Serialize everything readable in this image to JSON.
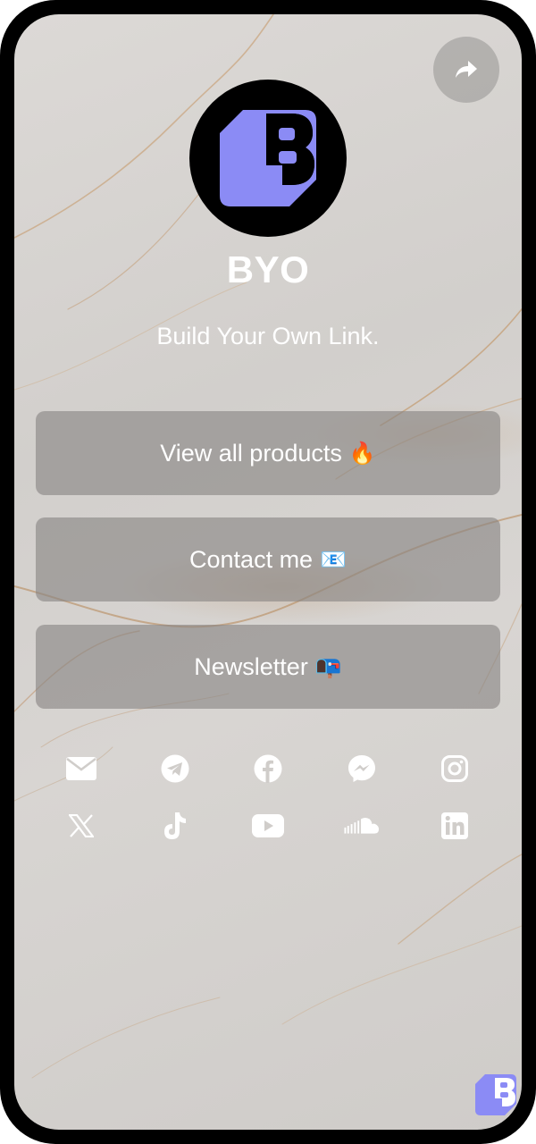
{
  "profile": {
    "name": "BYO",
    "bio": "Build Your Own Link."
  },
  "links": [
    {
      "label": "View all products",
      "emoji": "🔥"
    },
    {
      "label": "Contact me",
      "emoji": "📧"
    },
    {
      "label": "Newsletter",
      "emoji": "📭"
    }
  ],
  "socials": {
    "row1": [
      "email-icon",
      "telegram-icon",
      "facebook-icon",
      "messenger-icon",
      "instagram-icon"
    ],
    "row2": [
      "x-icon",
      "tiktok-icon",
      "youtube-icon",
      "soundcloud-icon",
      "linkedin-icon"
    ]
  },
  "colors": {
    "brand": "#8b8bf5",
    "frame": "#000000",
    "text": "#ffffff"
  }
}
